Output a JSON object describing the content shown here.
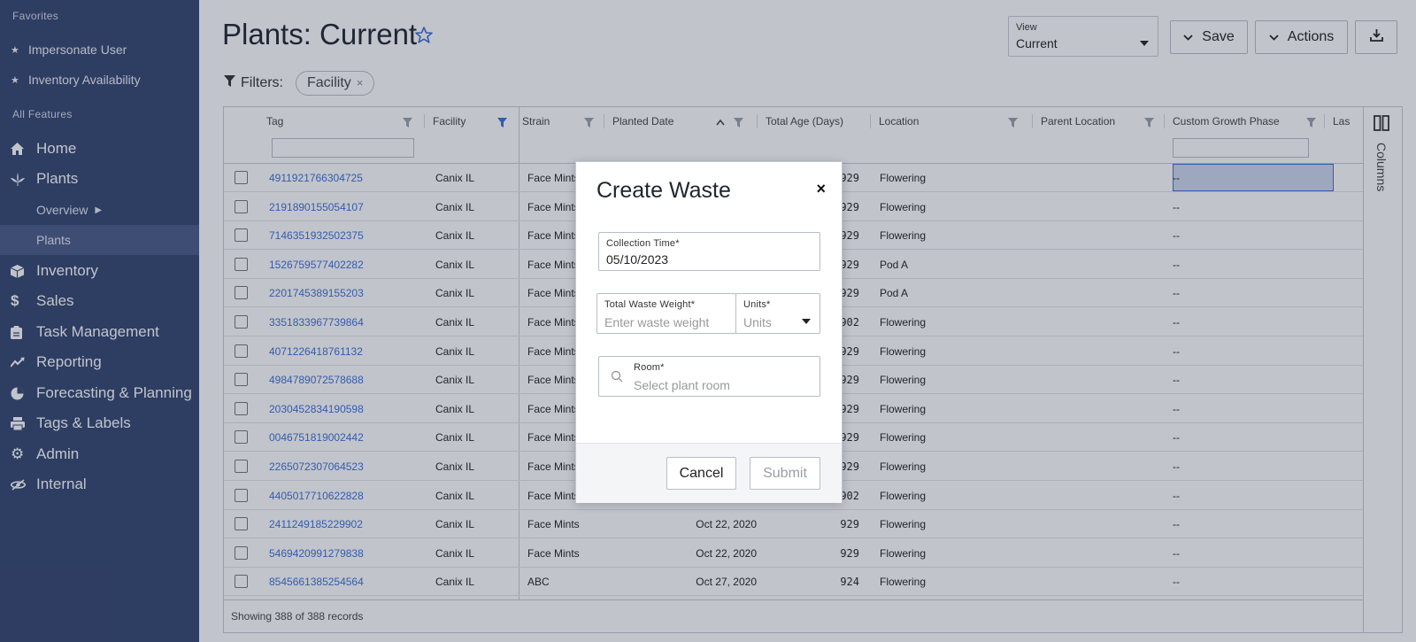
{
  "sidebar": {
    "favorites_title": "Favorites",
    "favorites": [
      {
        "label": "Impersonate User"
      },
      {
        "label": "Inventory Availability"
      }
    ],
    "all_features_title": "All Features",
    "nav": [
      {
        "label": "Home",
        "icon": "home-icon"
      },
      {
        "label": "Plants",
        "icon": "leaf-icon"
      },
      {
        "label": "Overview",
        "sub": true
      },
      {
        "label": "Plants",
        "sub": true,
        "active": true
      },
      {
        "label": "Inventory",
        "icon": "box-icon"
      },
      {
        "label": "Sales",
        "icon": "dollar-icon"
      },
      {
        "label": "Task Management",
        "icon": "clipboard-icon"
      },
      {
        "label": "Reporting",
        "icon": "trend-icon"
      },
      {
        "label": "Forecasting & Planning",
        "icon": "pie-icon"
      },
      {
        "label": "Tags & Labels",
        "icon": "printer-icon"
      },
      {
        "label": "Admin",
        "icon": "gear-icon"
      },
      {
        "label": "Internal",
        "icon": "eye-off-icon"
      }
    ]
  },
  "header": {
    "title": "Plants: Current",
    "view_label": "View",
    "view_value": "Current",
    "save_label": "Save",
    "actions_label": "Actions"
  },
  "filters": {
    "label": "Filters:",
    "chips": [
      "Facility"
    ],
    "chip_remove": "×"
  },
  "table": {
    "columns": [
      "Tag",
      "Facility",
      "Strain",
      "Planted Date",
      "Total Age (Days)",
      "Location",
      "Parent Location",
      "Custom Growth Phase",
      "Las"
    ],
    "rows": [
      {
        "tag": "4911921766304725",
        "facility": "Canix IL",
        "strain": "Face Mints",
        "planted": "",
        "age": "929",
        "location": "Flowering",
        "parent": "",
        "phase": "--"
      },
      {
        "tag": "2191890155054107",
        "facility": "Canix IL",
        "strain": "Face Mints",
        "planted": "",
        "age": "929",
        "location": "Flowering",
        "parent": "",
        "phase": "--"
      },
      {
        "tag": "7146351932502375",
        "facility": "Canix IL",
        "strain": "Face Mints",
        "planted": "",
        "age": "929",
        "location": "Flowering",
        "parent": "",
        "phase": "--"
      },
      {
        "tag": "1526759577402282",
        "facility": "Canix IL",
        "strain": "Face Mints",
        "planted": "",
        "age": "929",
        "location": "Pod A",
        "parent": "",
        "phase": "--"
      },
      {
        "tag": "2201745389155203",
        "facility": "Canix IL",
        "strain": "Face Mints",
        "planted": "",
        "age": "929",
        "location": "Pod A",
        "parent": "",
        "phase": "--"
      },
      {
        "tag": "3351833967739864",
        "facility": "Canix IL",
        "strain": "Face Mints",
        "planted": "",
        "age": "902",
        "location": "Flowering",
        "parent": "",
        "phase": "--"
      },
      {
        "tag": "4071226418761132",
        "facility": "Canix IL",
        "strain": "Face Mints",
        "planted": "",
        "age": "929",
        "location": "Flowering",
        "parent": "",
        "phase": "--"
      },
      {
        "tag": "4984789072578688",
        "facility": "Canix IL",
        "strain": "Face Mints",
        "planted": "",
        "age": "929",
        "location": "Flowering",
        "parent": "",
        "phase": "--"
      },
      {
        "tag": "2030452834190598",
        "facility": "Canix IL",
        "strain": "Face Mints",
        "planted": "",
        "age": "929",
        "location": "Flowering",
        "parent": "",
        "phase": "--"
      },
      {
        "tag": "0046751819002442",
        "facility": "Canix IL",
        "strain": "Face Mints",
        "planted": "",
        "age": "929",
        "location": "Flowering",
        "parent": "",
        "phase": "--"
      },
      {
        "tag": "2265072307064523",
        "facility": "Canix IL",
        "strain": "Face Mints",
        "planted": "",
        "age": "929",
        "location": "Flowering",
        "parent": "",
        "phase": "--"
      },
      {
        "tag": "4405017710622828",
        "facility": "Canix IL",
        "strain": "Face Mints",
        "planted": "",
        "age": "902",
        "location": "Flowering",
        "parent": "",
        "phase": "--"
      },
      {
        "tag": "2411249185229902",
        "facility": "Canix IL",
        "strain": "Face Mints",
        "planted": "Oct 22, 2020",
        "age": "929",
        "location": "Flowering",
        "parent": "",
        "phase": "--"
      },
      {
        "tag": "5469420991279838",
        "facility": "Canix IL",
        "strain": "Face Mints",
        "planted": "Oct 22, 2020",
        "age": "929",
        "location": "Flowering",
        "parent": "",
        "phase": "--"
      },
      {
        "tag": "8545661385254564",
        "facility": "Canix IL",
        "strain": "ABC",
        "planted": "Oct 27, 2020",
        "age": "924",
        "location": "Flowering",
        "parent": "",
        "phase": "--"
      }
    ],
    "footer": "Showing 388 of 388 records",
    "columns_panel_label": "Columns"
  },
  "modal": {
    "title": "Create Waste",
    "close": "×",
    "collection_time_label": "Collection Time*",
    "collection_time_value": "05/10/2023",
    "weight_label": "Total Waste Weight*",
    "weight_placeholder": "Enter waste weight",
    "units_label": "Units*",
    "units_placeholder": "Units",
    "room_label": "Room*",
    "room_placeholder": "Select plant room",
    "cancel_label": "Cancel",
    "submit_label": "Submit"
  },
  "colors": {
    "sidebar_bg": "#34446e",
    "link": "#3b6fd6",
    "overlay": "rgba(33,43,70,0.28)"
  }
}
